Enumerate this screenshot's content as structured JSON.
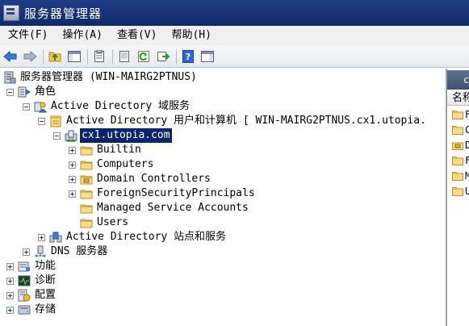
{
  "window": {
    "title": "服务器管理器"
  },
  "menu": [
    "文件(F)",
    "操作(A)",
    "查看(V)",
    "帮助(H)"
  ],
  "toolbar": [
    "back-icon",
    "forward-icon",
    "up-folder-icon",
    "show-hide-tree-icon",
    "properties-icon",
    "export-list-icon",
    "refresh-icon",
    "run-icon",
    "help-icon",
    "console-tree-icon"
  ],
  "tree": {
    "root": "服务器管理器 (WIN-MAIRG2PTNUS)",
    "roles": "角色",
    "ad_ds": "Active Directory 域服务",
    "ad_uc": "Active Directory 用户和计算机 [ WIN-MAIRG2PTNUS.cx1.utopia.",
    "domain": "cx1.utopia.com",
    "ou": [
      "Builtin",
      "Computers",
      "Domain Controllers",
      "ForeignSecurityPrincipals",
      "Managed Service Accounts",
      "Users"
    ],
    "ad_sites": "Active Directory 站点和服务",
    "dns": "DNS 服务器",
    "features": "功能",
    "diagnostics": "诊断",
    "configuration": "配置",
    "storage": "存储"
  },
  "right_pane": {
    "header": "c",
    "column": "名称",
    "rows": [
      "F",
      "C",
      "D",
      "F",
      "M",
      "U"
    ]
  }
}
